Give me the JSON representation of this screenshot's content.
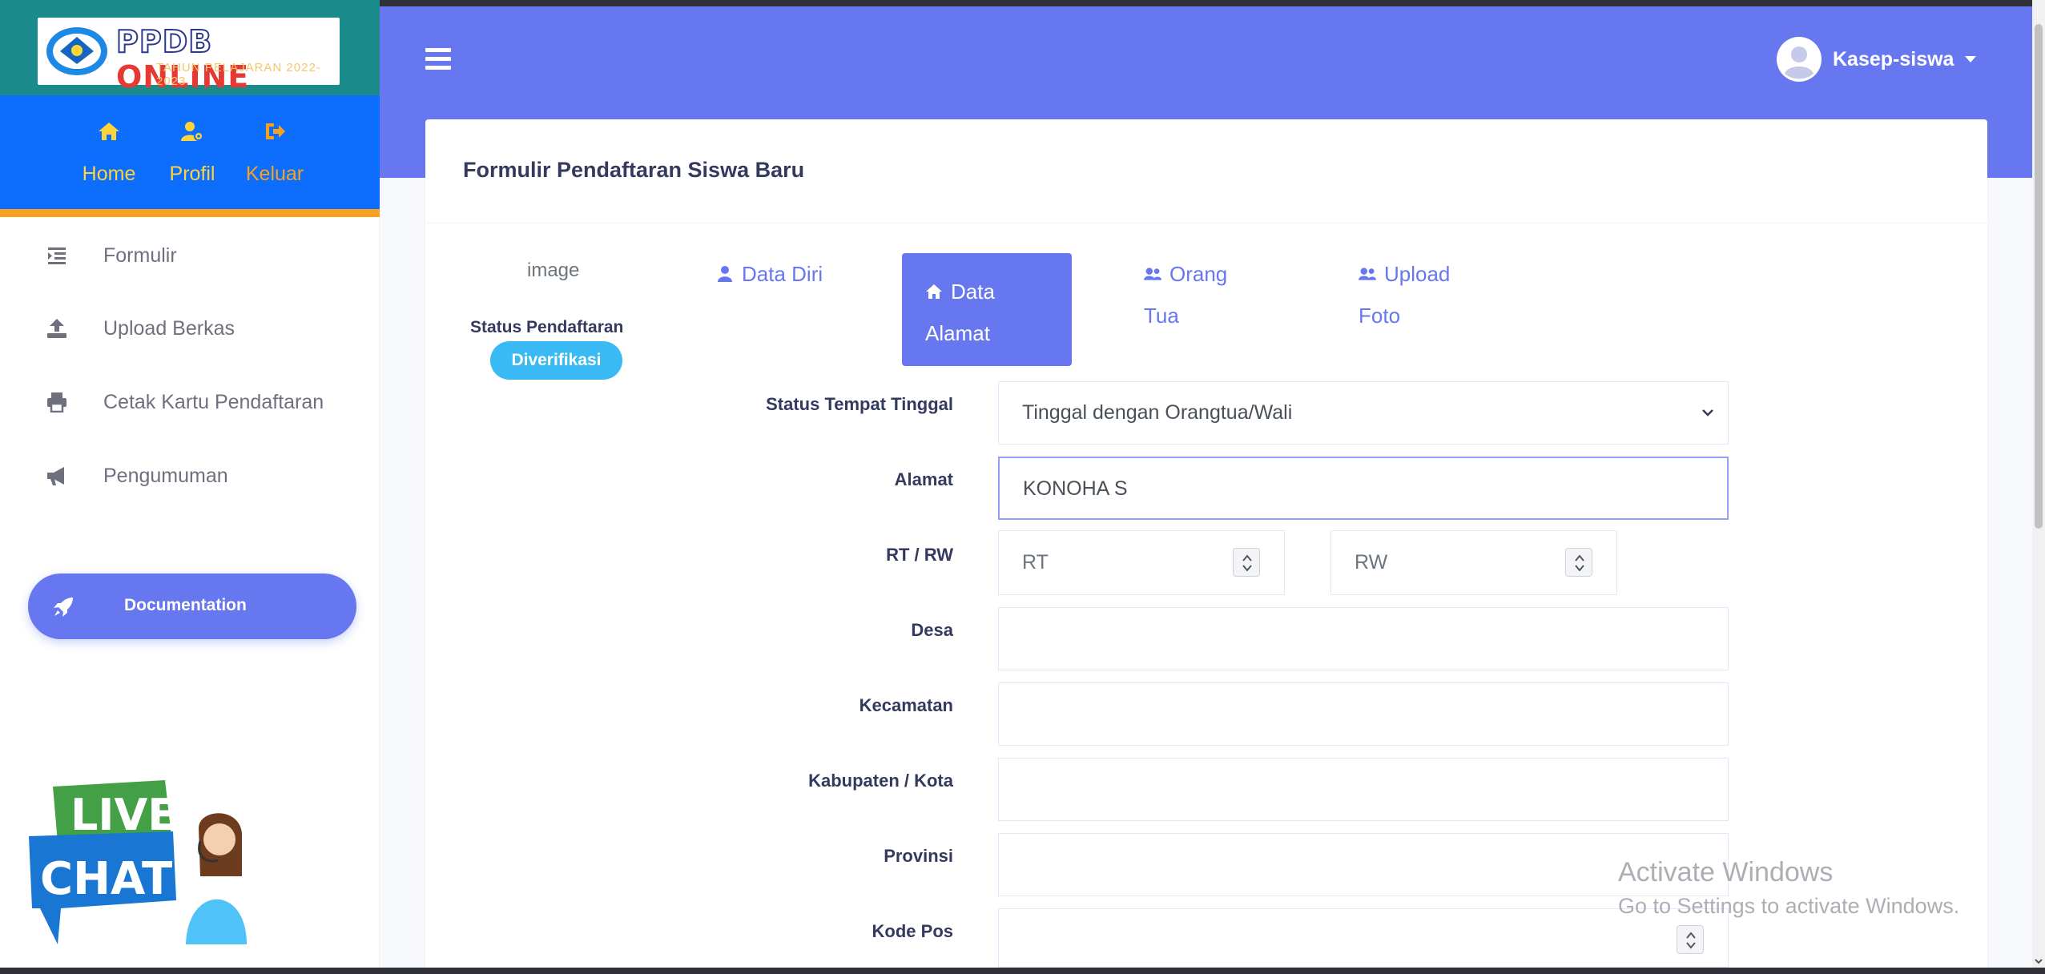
{
  "brand": {
    "title_part1": "PPDB",
    "title_part2": "ONLINE",
    "subtitle": "TAHUN PELAJARAN 2022-2023"
  },
  "topnav": [
    {
      "label": "Home",
      "icon": "home-icon",
      "color": "#ffd43b"
    },
    {
      "label": "Profil",
      "icon": "user-gear-icon",
      "color": "#ffd43b"
    },
    {
      "label": "Keluar",
      "icon": "sign-out-icon",
      "color": "#f6a21e"
    }
  ],
  "sidebar": {
    "items": [
      {
        "label": "Formulir",
        "icon": "list-indent-icon"
      },
      {
        "label": "Upload Berkas",
        "icon": "upload-icon"
      },
      {
        "label": "Cetak Kartu Pendaftaran",
        "icon": "print-icon"
      },
      {
        "label": "Pengumuman",
        "icon": "megaphone-icon"
      }
    ],
    "doc_button": "Documentation",
    "livechat": {
      "line1": "LIVE",
      "line2": "CHAT"
    }
  },
  "header": {
    "username": "Kasep-siswa"
  },
  "card": {
    "title": "Formulir Pendaftaran Siswa Baru",
    "image_alt": "image",
    "status_label": "Status Pendaftaran",
    "status_badge": "Diverifikasi",
    "tabs": [
      {
        "line1": "Data Diri",
        "line2": "",
        "icon": "user-icon",
        "active": false
      },
      {
        "line1": "Data",
        "line2": "Alamat",
        "icon": "home-icon",
        "active": true
      },
      {
        "line1": "Orang",
        "line2": "Tua",
        "icon": "users-icon",
        "active": false
      },
      {
        "line1": "Upload",
        "line2": "Foto",
        "icon": "users-icon",
        "active": false
      }
    ]
  },
  "form": {
    "status_tempat_tinggal": {
      "label": "Status Tempat Tinggal",
      "value": "Tinggal dengan Orangtua/Wali"
    },
    "alamat": {
      "label": "Alamat",
      "value": "KONOHA S"
    },
    "rtrw": {
      "label": "RT / RW",
      "rt_placeholder": "RT",
      "rw_placeholder": "RW"
    },
    "desa": {
      "label": "Desa",
      "value": ""
    },
    "kecamatan": {
      "label": "Kecamatan",
      "value": ""
    },
    "kabupaten": {
      "label": "Kabupaten / Kota",
      "value": ""
    },
    "provinsi": {
      "label": "Provinsi",
      "value": ""
    },
    "kodepos": {
      "label": "Kode Pos",
      "value": ""
    }
  },
  "watermark": {
    "line1": "Activate Windows",
    "line2": "Go to Settings to activate Windows."
  },
  "colors": {
    "primary": "#6777ef",
    "brand_bg": "#1b8a8a",
    "nav_blue": "#0d6efd",
    "accent_orange": "#f6a21e",
    "badge_info": "#3abaf4"
  }
}
